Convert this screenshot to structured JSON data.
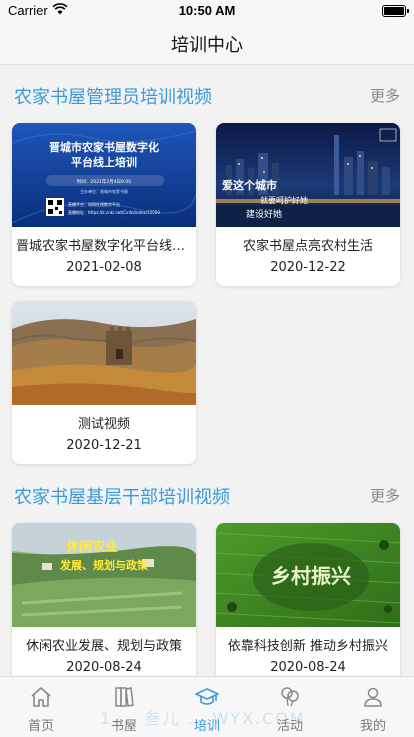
{
  "status": {
    "carrier": "Carrier",
    "time": "10:50 AM"
  },
  "nav": {
    "title": "培训中心"
  },
  "sections": [
    {
      "title": "农家书屋管理员培训视频",
      "more": "更多",
      "videos": [
        {
          "title": "晋城农家书屋数字化平台线上…",
          "date": "2021-02-08",
          "thumb_heading": "晋城市农家书屋数字化",
          "thumb_subheading": "平台线上培训",
          "thumb_line1": "时间：2021年2月4日9:00",
          "thumb_line2": "主办单位：晋城市农家书屋",
          "thumb_line3": "直播平台：知网在线数字平台",
          "thumb_line4": "直播地址：https://k.cnki.net/Cinfo/index/12550"
        },
        {
          "title": "农家书屋点亮农村生活",
          "date": "2020-12-22",
          "thumb_text1": "爱这个城市",
          "thumb_text2": "就要呵护好她",
          "thumb_text3": "建设好她"
        },
        {
          "title": "测试视频",
          "date": "2020-12-21"
        }
      ]
    },
    {
      "title": "农家书屋基层干部培训视频",
      "more": "更多",
      "videos": [
        {
          "title": "休闲农业发展、规划与政策",
          "date": "2020-08-24",
          "thumb_text1": "休闲农业",
          "thumb_text2": "发展、规划与政策"
        },
        {
          "title": "依靠科技创新 推动乡村振兴",
          "date": "2020-08-24",
          "thumb_text1": "乡村振兴"
        }
      ]
    }
  ],
  "tabs": [
    {
      "label": "首页",
      "icon": "home-icon"
    },
    {
      "label": "书屋",
      "icon": "bookshelf-icon"
    },
    {
      "label": "培训",
      "icon": "graduation-cap-icon",
      "active": true
    },
    {
      "label": "活动",
      "icon": "activity-icon"
    },
    {
      "label": "我的",
      "icon": "profile-icon"
    }
  ],
  "watermark": "1 … 叁儿 … WYX.COM",
  "colors": {
    "accent": "#3a9ad9",
    "background": "#f2f2f2"
  }
}
